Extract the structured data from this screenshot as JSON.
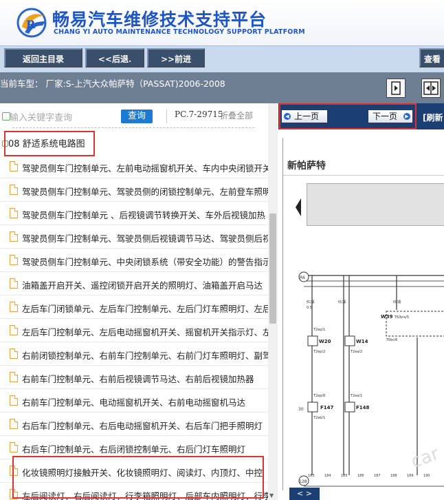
{
  "header": {
    "title": "畅易汽车维修技术支持平台",
    "subtitle": "CHANG YI AUTO MAINTENANCE TECHNOLOGY SUPPORT PLATFORM",
    "logo": "cy-logo"
  },
  "toolbar": {
    "home_label": "返回主目录",
    "back_label": "<<后退.",
    "forward_label": ">>前进",
    "view_label": "查看"
  },
  "model_row": {
    "text": "当前车型： 厂家:S-上汽大众帕萨特（PASSAT)2006-2008"
  },
  "search": {
    "placeholder": "输入关键字查询",
    "button": "查询",
    "pc_code": "PC.7-29715",
    "collapse_all": "折叠全部"
  },
  "tree": {
    "root_label": "08 舒适系统电路图",
    "items": [
      {
        "label": "驾驶员侧车门控制单元、左前电动摇窗机开关、车内中央闭锁开关"
      },
      {
        "label": "驾驶员侧车门控制单元、驾驶员侧的闭锁控制单元、左前登车照明灯"
      },
      {
        "label": "驾驶员侧车门控制单元 、后视镜调节转换开关、车外后视镜加热"
      },
      {
        "label": "驾驶员侧车门控制单元、驾驶员侧后视镜调节马达、驾驶员侧后视镜"
      },
      {
        "label": "驾驶员侧车门控制单元、中央闭锁系统（带安全功能）的警告指示灯"
      },
      {
        "label": "油箱盖开启开关、遥控闭锁开启开关的照明灯、油箱盖开启马达"
      },
      {
        "label": "左后车门闭锁单元、左后车门控制单元、左后门灯车照明灯、左后"
      },
      {
        "label": "左后车门控制单元、左后电动摇窗机开关、摇窗机开关指示灯、左后"
      },
      {
        "label": "右前闭锁控制单元、右前车门控制单元、右前门灯车照明灯、副驾驶"
      },
      {
        "label": "右前车门控制单元、右前后视镜调节马达、右前后视镜加热器"
      },
      {
        "label": "右前车门控制单元、电动摇窗机开关、右前电动摇窗机马达"
      },
      {
        "label": "右后车门控制单元、右后电动摇窗机开关、右后车门把手照明灯"
      },
      {
        "label": "右后车门控制单元、右后闭锁控制单元、右后门灯车照明灯"
      },
      {
        "label": "化妆镜照明灯接触开关、化妆镜照明灯、阅读灯、内顶灯、中控"
      },
      {
        "label": "左后阅读灯、右后阅读灯、行李箱照明灯、后部车内照明灯、行李"
      }
    ]
  },
  "viewer": {
    "prev_label": "上一页",
    "next_label": "下一页",
    "refresh_label": "[刷新",
    "doc_title": "新帕萨特",
    "watermark": "car",
    "nav_label": "< >",
    "diagram": {
      "left_label": "R6",
      "bottom_left_label": "128",
      "top_mark": "30",
      "components": [
        "W20",
        "W14",
        "W39",
        "F147",
        "F148"
      ],
      "wire_labels": [
        "红/黑",
        "0.5",
        "T2ep/1",
        "T2ep/2",
        "T2ea/2",
        "T6/bra/5",
        "T6br/6",
        "T2ep/6",
        "T2ea/1",
        "T2eb/1"
      ],
      "scale": [
        "183",
        "184",
        "185",
        "186",
        "187",
        "188",
        "189",
        "190"
      ]
    }
  },
  "colors": {
    "brand_blue": "#1d55c4",
    "toolbar_button": "#3a4f6b",
    "model_bar": "#6f7f93",
    "viewer_bar": "#1c3f73",
    "highlight": "#e03030",
    "query_button": "#1d7ad4"
  }
}
